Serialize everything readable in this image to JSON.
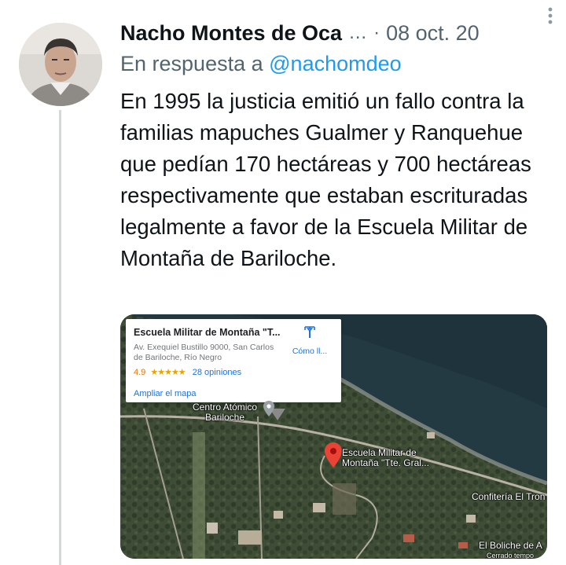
{
  "tweet": {
    "author_name": "Nacho Montes de Oca",
    "ellipsis": "…",
    "separator": "·",
    "date": "08 oct. 20",
    "reply_prefix": "En respuesta a",
    "reply_handle": "@nachomdeo",
    "text": "En 1995 la justicia emitió un fallo contra la familias mapuches Gualmer y Ranquehue que pedían 170 hectáreas y 700 hectáreas respectivamente que estaban escrituradas legalmente a favor de la Escuela Militar de Montaña de Bariloche."
  },
  "map_card": {
    "title": "Escuela Militar de Montaña \"T...",
    "address": "Av. Exequiel Bustillo 9000, San Carlos de Bariloche, Río Negro",
    "rating": "4.9",
    "stars": "★★★★★",
    "reviews": "28 opiniones",
    "enlarge_link": "Ampliar el mapa",
    "directions_label": "Cómo ll..."
  },
  "map_labels": {
    "centro_atomico": "Centro Atómico\nBariloche",
    "escuela": "Escuela Militar de\nMontaña \"Tte. Gral...",
    "confiteria": "Confitería El Tron",
    "boliche": "El Boliche de A",
    "boliche_sub": "Cerrado tempo"
  },
  "colors": {
    "link_blue": "#1d9bf0",
    "secondary_text": "#536471",
    "thread_line": "#cfd9de",
    "map_pin_red": "#ea4335"
  },
  "icons": {
    "more": "more-vertical-icon",
    "directions": "directions-icon",
    "pin": "map-pin-icon"
  }
}
